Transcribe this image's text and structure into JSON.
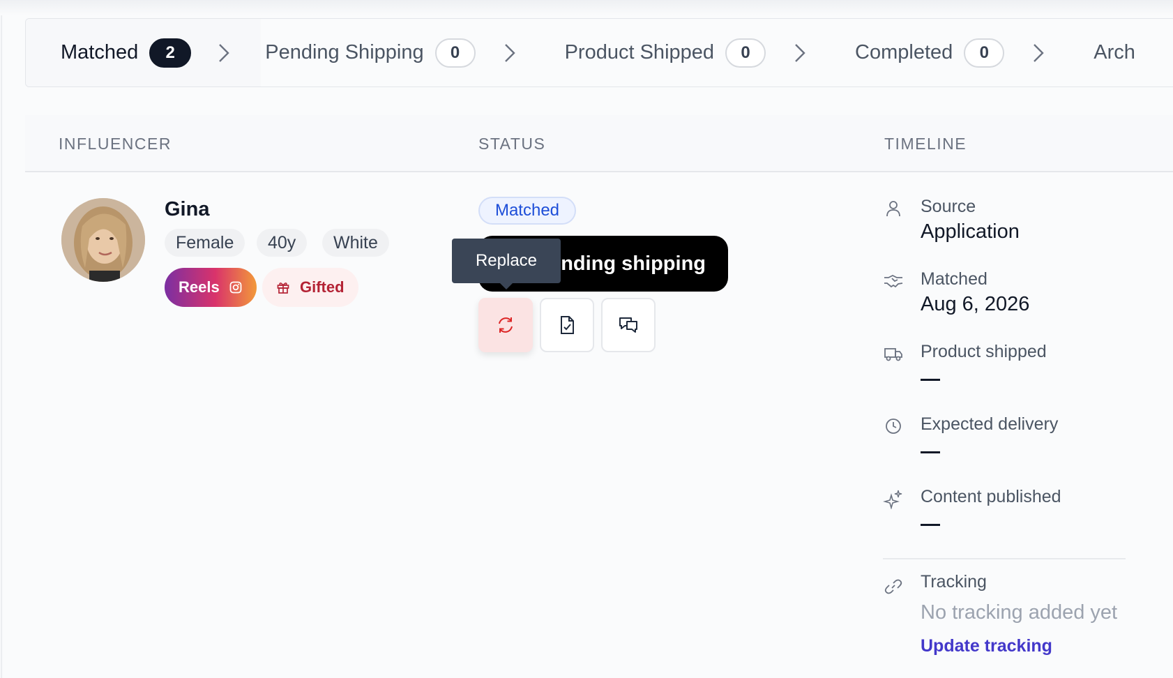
{
  "stepper": {
    "steps": [
      {
        "label": "Matched",
        "count": "2"
      },
      {
        "label": "Pending Shipping",
        "count": "0"
      },
      {
        "label": "Product Shipped",
        "count": "0"
      },
      {
        "label": "Completed",
        "count": "0"
      },
      {
        "label": "Arch"
      }
    ]
  },
  "table": {
    "headers": {
      "influencer": "INFLUENCER",
      "status": "STATUS",
      "timeline": "TIMELINE"
    }
  },
  "influencer": {
    "name": "Gina",
    "tags": [
      "Female",
      "40y",
      "White"
    ],
    "platform": "Reels",
    "deal_type": "Gifted"
  },
  "status": {
    "badge": "Matched",
    "tooltip_action": "Pending shipping",
    "tooltip_replace": "Replace"
  },
  "timeline": {
    "source_label": "Source",
    "source_value": "Application",
    "matched_label": "Matched",
    "matched_value": "Aug 6, 2026",
    "shipped_label": "Product shipped",
    "delivery_label": "Expected delivery",
    "published_label": "Content published",
    "tracking_label": "Tracking",
    "tracking_empty": "No tracking added yet",
    "update_link": "Update tracking"
  },
  "icons": {
    "chevron": "chevron-right-icon",
    "instagram": "instagram-icon",
    "gift": "gift-icon",
    "replace": "refresh-icon",
    "document": "document-check-icon",
    "chat": "chat-icon"
  },
  "colors": {
    "accent_blue": "#1d4ed8",
    "link_indigo": "#4338ca",
    "gifted_red": "#b42335",
    "replace_bg": "#fbe3e3"
  }
}
